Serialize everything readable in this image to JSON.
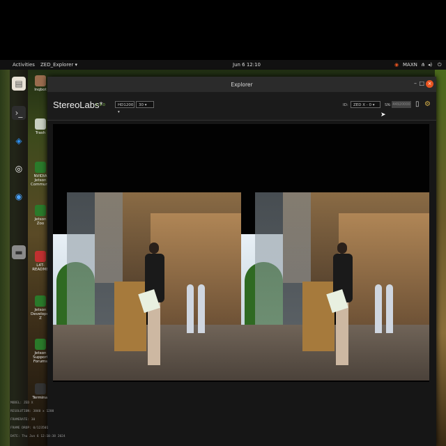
{
  "topbar": {
    "activities": "Activities",
    "app_menu": "ZED_Explorer ▾",
    "clock": "Jun 6 12:10",
    "status": "MAXN"
  },
  "window": {
    "title": "Explorer"
  },
  "header": {
    "brand": "StereoLabs*",
    "version": "1.3.0",
    "resolution_select": "HD1200 ▾",
    "fps_select": "30 ▾",
    "id_label": "ID:",
    "camera_select": "ZED X  - 0 ▾",
    "sn_label": "SN:",
    "sn_value": "44920000"
  },
  "desktop_icons": [
    "Inqbot",
    "Trash",
    "NVIDIA Jetson Community",
    "Jetson Zoo",
    "L4T-README",
    "Jetson Developer Z",
    "Jetson Support Forums",
    "Terminal"
  ],
  "info": {
    "model": "MODEL: ZED X",
    "resolution": "RESOLUTION: 3840 x 1200",
    "framerate": "FRAMERATE: 30",
    "frame_drop": "FRAME DROP: 0/123501",
    "date": "DATE: Thu Jun 6 12:10:38 2024"
  }
}
